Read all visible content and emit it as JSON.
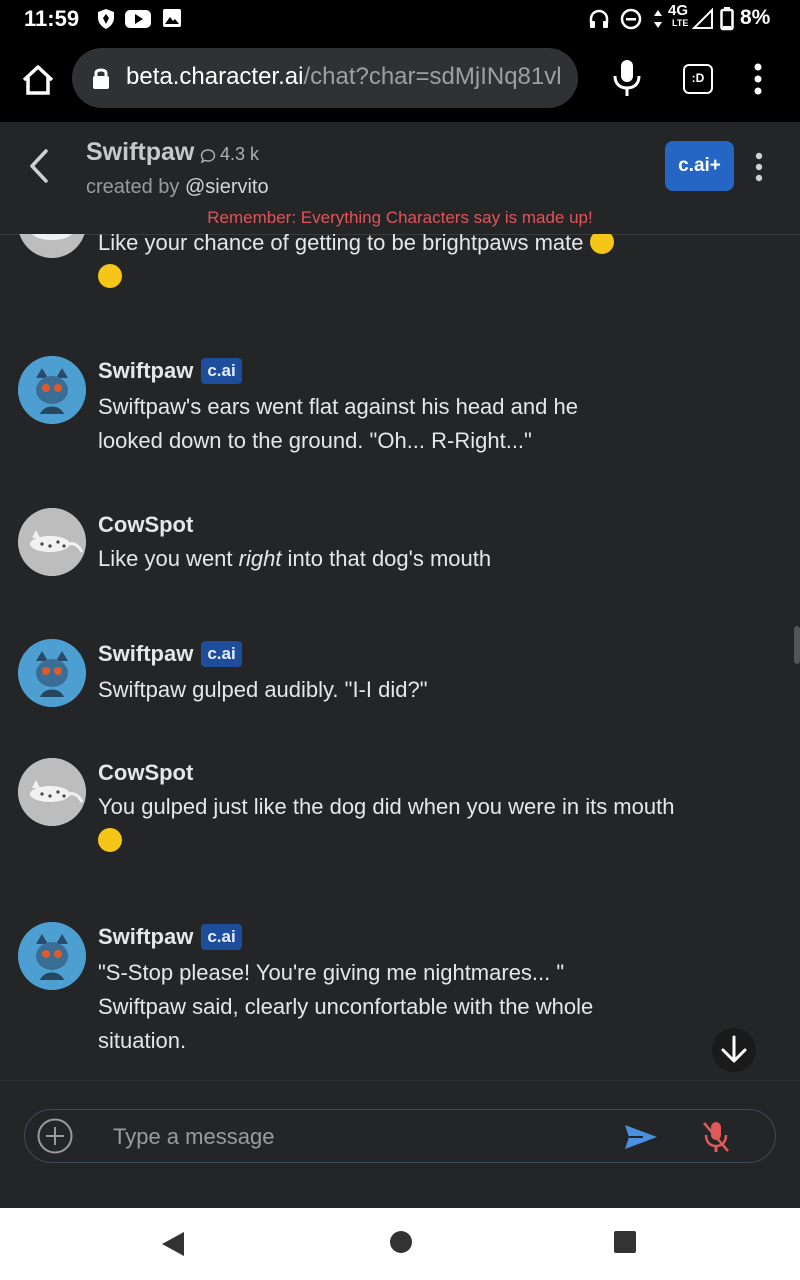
{
  "status_bar": {
    "time": "11:59",
    "network": "4G",
    "network_sub": "LTE",
    "battery": "8%",
    "icons": [
      "shield-icon",
      "youtube-icon",
      "image-icon",
      "headphones-icon",
      "dnd-icon",
      "data-arrows-icon",
      "signal-icon",
      "battery-icon"
    ]
  },
  "browser": {
    "url_host": "beta.character.ai",
    "url_path": "/chat?char=sdMjINq81vl",
    "tabs_label": ":D"
  },
  "header": {
    "character_name": "Swiftpaw",
    "chat_count": "4.3 k",
    "created_by_prefix": "created by",
    "creator": "@siervito",
    "plus_button": "c.ai+",
    "reminder": "Remember: Everything Characters say is made up!"
  },
  "messages": [
    {
      "author": "",
      "text": "Like your chance of getting to be brightpaws mate",
      "emojis": [
        "shushing-face-emoji",
        "tongue-wink-emoji"
      ]
    },
    {
      "author": "Swiftpaw",
      "badge": "c.ai",
      "text": "Swiftpaw's ears went flat against his head and he looked down to the ground. \"Oh... R-Right...\""
    },
    {
      "author": "CowSpot",
      "text_before": "Like you went ",
      "text_italic": "right",
      "text_after": " into that dog's mouth"
    },
    {
      "author": "Swiftpaw",
      "badge": "c.ai",
      "text": "Swiftpaw gulped audibly. \"I-I did?\""
    },
    {
      "author": "CowSpot",
      "text": "You gulped just like the dog did when you were in its mouth",
      "emojis": [
        "shushing-face-emoji"
      ]
    },
    {
      "author": "Swiftpaw",
      "badge": "c.ai",
      "text": "\"S-Stop please! You're giving me nightmares... \" Swiftpaw said, clearly unconfortable with the whole situation."
    }
  ],
  "composer": {
    "placeholder": "Type a message"
  },
  "colors": {
    "background": "#242526",
    "accent_blue": "#2565c4",
    "badge_blue": "#1e4d9c",
    "reminder_red": "#e0545a",
    "send_blue": "#4a90e2",
    "mic_off_red": "#e05a5a"
  }
}
